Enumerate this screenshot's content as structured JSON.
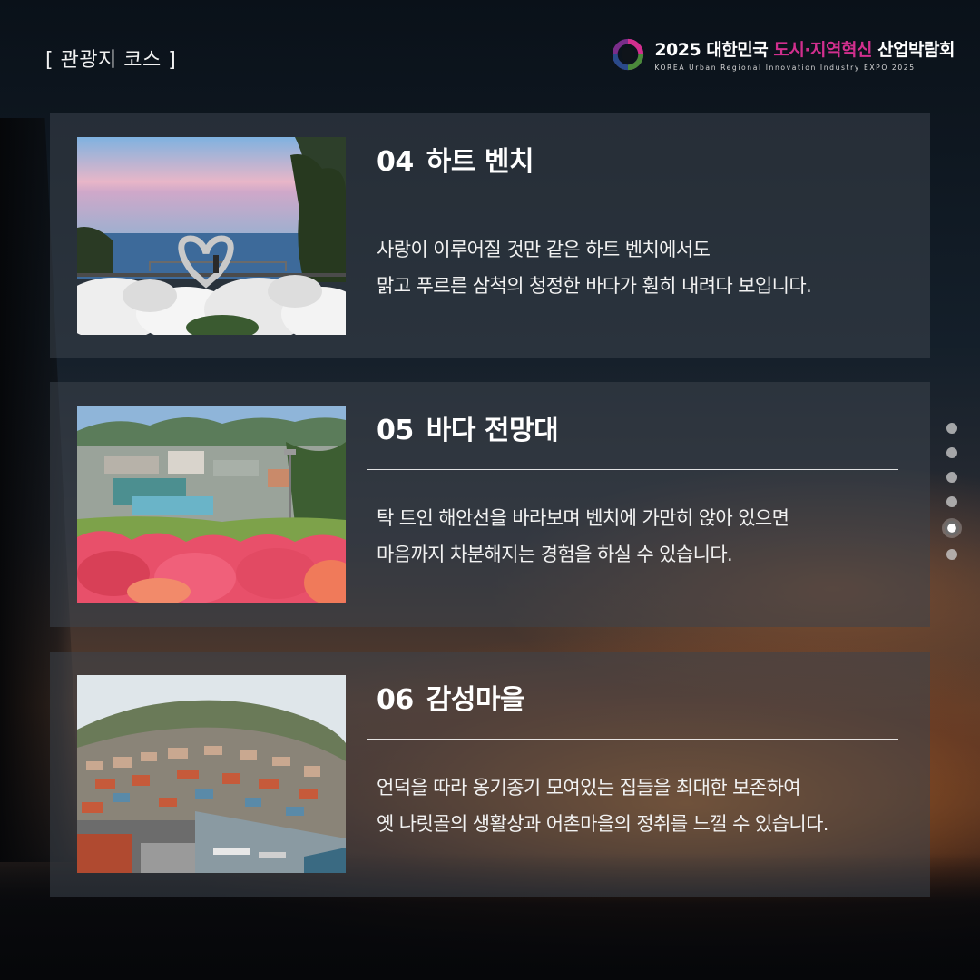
{
  "header": {
    "label": "[ 관광지 코스 ]"
  },
  "logo": {
    "title_main": "2025 대한민국",
    "title_accent": "도시·지역혁신",
    "title_end": "산업박람회",
    "subtitle": "KOREA Urban Regional Innovation Industry EXPO 2025",
    "icon": "circle-logo-icon",
    "accent_color": "#d22f8e"
  },
  "cards": [
    {
      "number": "04",
      "title": "하트 벤치",
      "lines": [
        "사랑이 이루어질 것만 같은 하트 벤치에서도",
        "맑고 푸르른 삼척의 청정한 바다가 훤히 내려다 보입니다."
      ]
    },
    {
      "number": "05",
      "title": "바다 전망대",
      "lines": [
        "탁 트인 해안선을 바라보며 벤치에 가만히 앉아 있으면",
        "마음까지 차분해지는 경험을 하실 수 있습니다."
      ]
    },
    {
      "number": "06",
      "title": "감성마을",
      "lines": [
        "언덕을 따라 옹기종기 모여있는 집들을 최대한 보존하여",
        "옛 나릿골의 생활상과 어촌마을의 정취를 느낄 수 있습니다."
      ]
    }
  ],
  "pager": {
    "total": 6,
    "active_index": 5
  }
}
